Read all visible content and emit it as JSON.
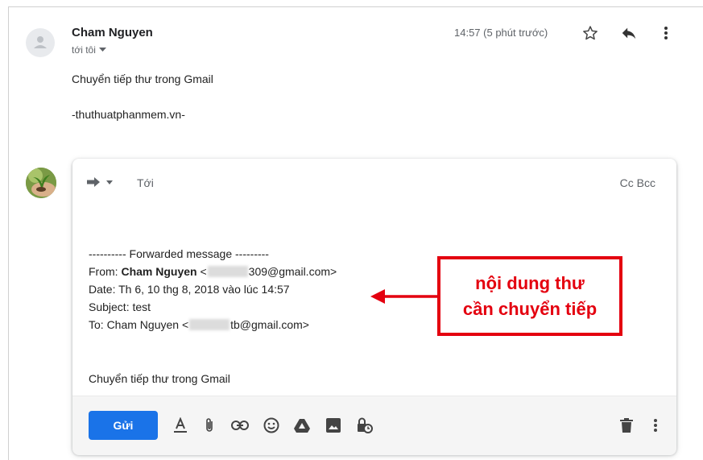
{
  "message": {
    "sender": "Cham Nguyen",
    "recipient_label": "tới tôi",
    "time": "14:57 (5 phút trước)",
    "body_lines": [
      "Chuyển tiếp thư trong Gmail",
      "-thuthuatphanmem.vn-"
    ]
  },
  "compose": {
    "to_label": "Tới",
    "cc_label": "Cc",
    "bcc_label": "Bcc",
    "forward_header": "---------- Forwarded message ---------",
    "from_label": "From: ",
    "from_name": "Cham Nguyen",
    "from_email_prefix": " <",
    "from_email_suffix": "309@gmail.com>",
    "date_line": "Date: Th 6, 10 thg 8, 2018 vào lúc 14:57",
    "subject_line": "Subject: test",
    "to_line_prefix": "To: Cham Nguyen <",
    "to_email_suffix": "tb@gmail.com>",
    "quoted_text": "Chuyển tiếp thư trong Gmail",
    "send_label": "Gửi"
  },
  "annotation": {
    "line1": "nội dung thư",
    "line2": "cần chuyển tiếp",
    "color": "#e4000f"
  },
  "colors": {
    "send_button": "#1a73e8",
    "icon_gray": "#5f6368"
  }
}
